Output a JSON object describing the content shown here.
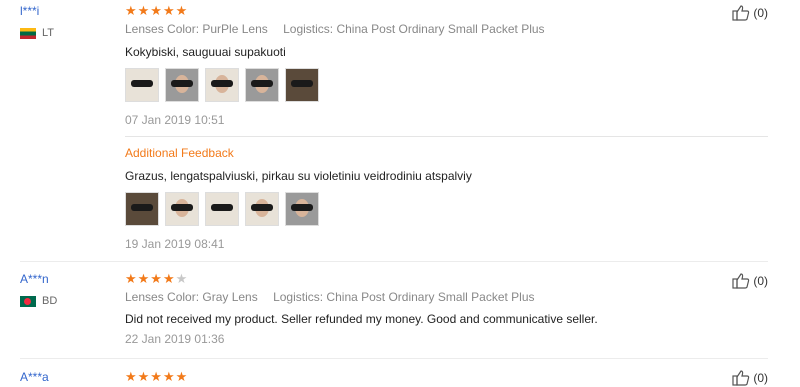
{
  "reviews": [
    {
      "user": "l***i",
      "country": "LT",
      "stars": 5,
      "stars_text": "★★★★★",
      "lenses": "Lenses Color: PurPle Lens",
      "logistics": "Logistics: China Post Ordinary Small Packet Plus",
      "text": "Kokybiski, sauguuai supakuoti",
      "date": "07 Jan 2019 10:51",
      "likes": "(0)",
      "additional": {
        "label": "Additional Feedback",
        "text": "Grazus, lengatspalviuski, pirkau su violetiniu veidrodiniu atspalviy",
        "date": "19 Jan 2019 08:41"
      }
    },
    {
      "user": "A***n",
      "country": "BD",
      "stars": 4,
      "stars_text": "★★★★",
      "stars_off": "★",
      "lenses": "Lenses Color: Gray Lens",
      "logistics": "Logistics: China Post Ordinary Small Packet Plus",
      "text": "Did not received my product. Seller refunded my money. Good and communicative seller.",
      "date": "22 Jan 2019 01:36",
      "likes": "(0)"
    },
    {
      "user": "A***a",
      "stars": 5,
      "stars_text": "★★★★★",
      "likes": "(0)"
    }
  ]
}
